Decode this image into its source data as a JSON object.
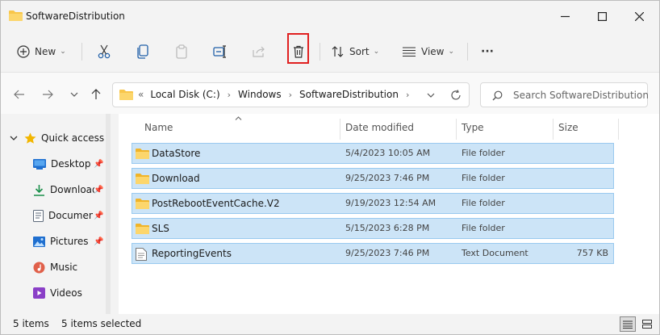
{
  "window": {
    "title": "SoftwareDistribution"
  },
  "toolbar": {
    "new_label": "New",
    "sort_label": "Sort",
    "view_label": "View",
    "more_label": "···"
  },
  "address": {
    "overflow": "«",
    "crumbs": [
      "Local Disk (C:)",
      "Windows",
      "SoftwareDistribution"
    ],
    "search_placeholder": "Search SoftwareDistribution"
  },
  "sidebar": {
    "items": [
      {
        "label": "Quick access",
        "icon": "star-icon",
        "color": "#f2b600"
      },
      {
        "label": "Desktop",
        "icon": "desktop-icon",
        "color": "#1f6fcf"
      },
      {
        "label": "Downloads",
        "icon": "download-icon",
        "color": "#1a8f4a"
      },
      {
        "label": "Documents",
        "icon": "document-icon",
        "color": "#5d6a7a"
      },
      {
        "label": "Pictures",
        "icon": "pictures-icon",
        "color": "#1f6fcf"
      },
      {
        "label": "Music",
        "icon": "music-icon",
        "color": "#e0604a"
      },
      {
        "label": "Videos",
        "icon": "videos-icon",
        "color": "#8a3fc7"
      }
    ]
  },
  "columns": {
    "name": "Name",
    "date": "Date modified",
    "type": "Type",
    "size": "Size"
  },
  "files": [
    {
      "name": "DataStore",
      "date": "5/4/2023 10:05 AM",
      "type": "File folder",
      "size": "",
      "icon": "folder-icon"
    },
    {
      "name": "Download",
      "date": "9/25/2023 7:46 PM",
      "type": "File folder",
      "size": "",
      "icon": "folder-icon"
    },
    {
      "name": "PostRebootEventCache.V2",
      "date": "9/19/2023 12:54 AM",
      "type": "File folder",
      "size": "",
      "icon": "folder-icon"
    },
    {
      "name": "SLS",
      "date": "5/15/2023 6:28 PM",
      "type": "File folder",
      "size": "",
      "icon": "folder-icon"
    },
    {
      "name": "ReportingEvents",
      "date": "9/25/2023 7:46 PM",
      "type": "Text Document",
      "size": "757 KB",
      "icon": "text-file-icon"
    }
  ],
  "status": {
    "count": "5 items",
    "selected": "5 items selected"
  },
  "colors": {
    "accent": "#0067c0",
    "selection": "#cce4f7",
    "folder": "#f8c64a",
    "highlight_box": "#e02020"
  }
}
